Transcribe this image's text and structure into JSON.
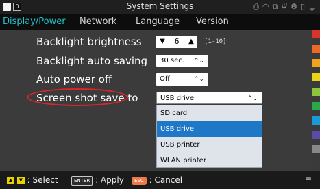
{
  "title": "System Settings",
  "title_badge": "0",
  "tabs": [
    {
      "label": "Display/Power",
      "active": true
    },
    {
      "label": "Network",
      "active": false
    },
    {
      "label": "Language",
      "active": false
    },
    {
      "label": "Version",
      "active": false
    }
  ],
  "settings": {
    "backlight_brightness": {
      "label": "Backlight brightness",
      "value": "6",
      "range": "[1-10]"
    },
    "backlight_auto_saving": {
      "label": "Backlight auto saving",
      "value": "30 sec."
    },
    "auto_power_off": {
      "label": "Auto power off",
      "value": "Off"
    },
    "screenshot_save_to": {
      "label": "Screen shot save to",
      "value": "USB drive"
    }
  },
  "dropdown_options": [
    {
      "label": "SD card",
      "selected": false
    },
    {
      "label": "USB drive",
      "selected": true
    },
    {
      "label": "USB printer",
      "selected": false
    },
    {
      "label": "WLAN printer",
      "selected": false
    }
  ],
  "footer": {
    "select_label": ": Select",
    "enter_key": "ENTER",
    "apply_label": ": Apply",
    "esc_key": "ESC",
    "cancel_label": ": Cancel"
  },
  "accent_colors": {
    "active_tab": "#25c1c9",
    "selection": "#1f77c8",
    "highlight_ellipse": "#e0242a",
    "arrow_keys": "#e6d400",
    "esc_key": "#f07a46"
  },
  "right_strip_colors": [
    "#d8342c",
    "#e86a24",
    "#f0a21c",
    "#e8d21a",
    "#8cc63f",
    "#2aa84a",
    "#1a9bd7",
    "#5b4aa8",
    "#888888"
  ]
}
